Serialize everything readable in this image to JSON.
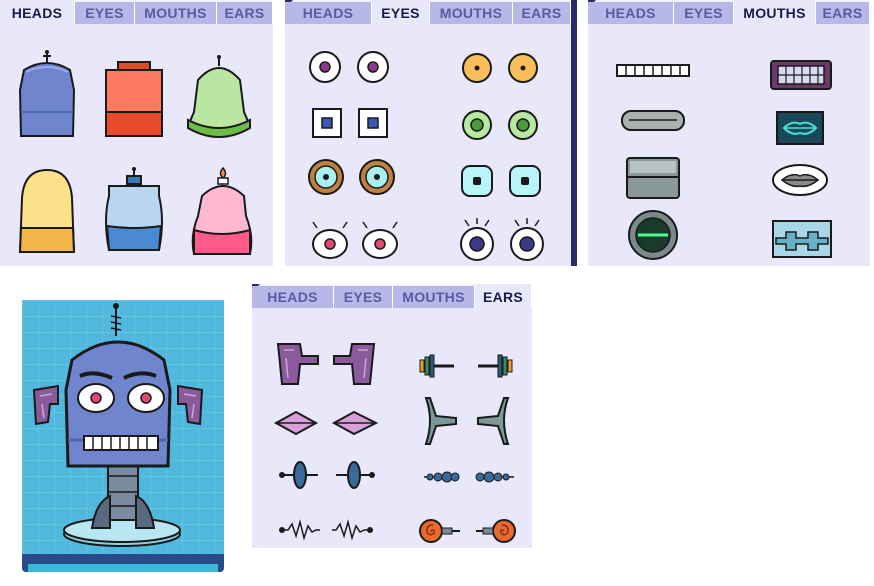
{
  "tabs": {
    "heads": "HEADS",
    "eyes": "EYES",
    "mouths": "MOUTHS",
    "ears": "EARS"
  },
  "panels": {
    "heads_panel": {
      "active_tab": "HEADS"
    },
    "eyes_panel": {
      "active_tab": "EYES"
    },
    "mouths_panel": {
      "active_tab": "MOUTHS"
    },
    "ears_panel": {
      "active_tab": "EARS"
    }
  },
  "heads": [
    "antenna-dome-head-blue",
    "square-head-red",
    "bell-head-green",
    "rounded-head-yellow",
    "jar-head-blue",
    "candle-head-pink"
  ],
  "eyes": [
    "eyes-purple-round",
    "eyes-orange-round",
    "eyes-blue-square",
    "eyes-green-round",
    "eyes-cyan-ringed",
    "eyes-cyan-rounded-square",
    "eyes-pink-lashed",
    "eyes-navy-lashed"
  ],
  "mouths": [
    "mouth-teeth-strip",
    "mouth-grill-purple",
    "mouth-capsule-gray",
    "mouth-lips-teal-screen",
    "mouth-box-gray",
    "mouth-lips-gray",
    "mouth-round-green-slot",
    "mouth-castle-teeth"
  ],
  "ears": [
    "ears-purple-bracket",
    "ears-dumbbell-rings",
    "ears-pink-diamond",
    "ears-horn",
    "ears-disc-spike",
    "ears-bead-chain",
    "ears-zigzag-antenna",
    "ears-orange-spiral"
  ],
  "colors": {
    "panel_bg": "#e8e8fa",
    "tab_bg": "#b8b8e8",
    "tab_text": "#5a5aa0",
    "tab_active_text": "#1a1a4a",
    "preview_bg": "#4fb8dc",
    "robot_blue": "#6f86cf"
  }
}
